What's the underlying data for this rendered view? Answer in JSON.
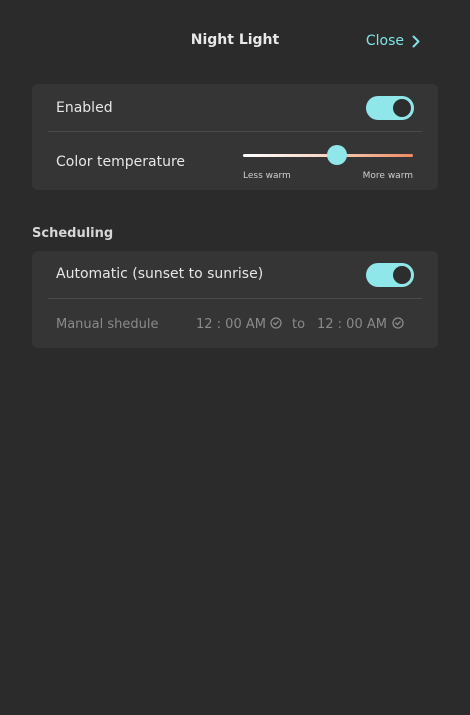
{
  "header": {
    "title": "Night Light",
    "close_label": "Close"
  },
  "display": {
    "enabled_label": "Enabled",
    "enabled_on": true,
    "color_temp_label": "Color temperature",
    "color_temp_value": 0.55,
    "slider_min_label": "Less warm",
    "slider_max_label": "More warm"
  },
  "scheduling": {
    "section_label": "Scheduling",
    "automatic_label": "Automatic (sunset to sunrise)",
    "automatic_on": true,
    "manual_label": "Manual shedule",
    "start_time": "12 : 00 AM",
    "to_label": "to",
    "end_time": "12 : 00 AM"
  },
  "colors": {
    "background": "#2b2b2b",
    "card": "#353535",
    "accent": "#8fe7ea",
    "warm": "#f08a62"
  },
  "icons": {
    "close": "chevron-right-icon",
    "clock": "clock-icon"
  }
}
